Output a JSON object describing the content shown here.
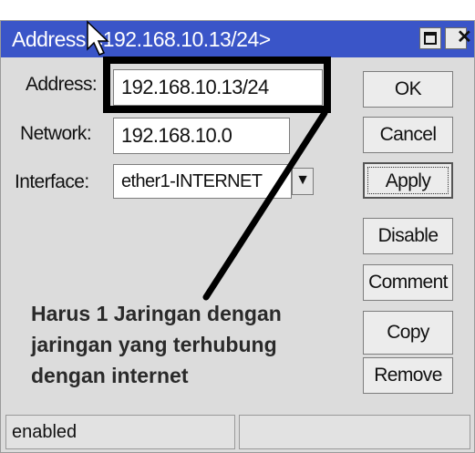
{
  "window": {
    "title": "Address <192.168.10.13/24>",
    "titlebar_buttons": [
      {
        "name": "maximize-icon",
        "glyph": "□"
      },
      {
        "name": "close-icon",
        "glyph": "✕"
      }
    ]
  },
  "form": {
    "address_label": "Address:",
    "address_value": "192.168.10.13/24",
    "network_label": "Network:",
    "network_value": "192.168.10.0",
    "interface_label": "Interface:",
    "interface_value": "ether1-INTERNET",
    "dropdown_icon": "▼"
  },
  "buttons": {
    "ok": "OK",
    "cancel": "Cancel",
    "apply": "Apply",
    "disable": "Disable",
    "comment": "Comment",
    "copy": "Copy",
    "remove": "Remove"
  },
  "annotation": {
    "lines": [
      "Harus 1 Jaringan dengan",
      "jaringan yang terhubung",
      "dengan internet"
    ]
  },
  "status": {
    "left": "enabled",
    "right": ""
  },
  "colors": {
    "titlebar": "#3a55c8",
    "window_bg": "#dcdcdc",
    "highlight": "#000000"
  }
}
